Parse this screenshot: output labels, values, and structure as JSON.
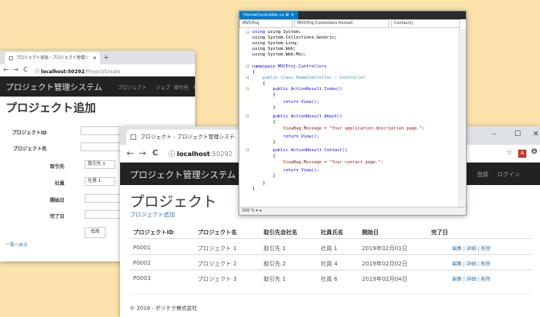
{
  "create_browser": {
    "tab_title": "プロジェクト追加 - プロジェクト管理シ",
    "url_host": "localhost:50292",
    "url_path": "/Project/Create",
    "brand": "プロジェクト管理システム",
    "nav": [
      "プロジェクト",
      "ジョブ",
      "取引先",
      "社員"
    ],
    "page_title": "プロジェクト追加",
    "fields": {
      "project_id": "プロジェクトID",
      "project_name": "プロジェクト名",
      "client": "取引先",
      "client_value": "取引先 1",
      "employee": "社員",
      "employee_value": "社員 1",
      "start_date": "開始日",
      "end_date": "完了日"
    },
    "add_button": "追加",
    "back_link": "一覧へ戻る"
  },
  "index_browser": {
    "tab_title": "プロジェクト - プロジェクト管理システ.",
    "url_host": "localhost",
    "url_port": ":50292",
    "brand": "プロジェクト管理システム",
    "nav_right": [
      "登録",
      "ログイン"
    ],
    "page_title": "プロジェクト",
    "create_link": "プロジェクト追加",
    "columns": [
      "プロジェクトID",
      "プロジェクト名",
      "取引先会社名",
      "社員氏名",
      "開始日",
      "完了日"
    ],
    "rows": [
      {
        "id": "P0001",
        "name": "プロジェクト 1",
        "client": "取引先 1",
        "employee": "社員 1",
        "start": "2019年02月01日",
        "end": ""
      },
      {
        "id": "P0002",
        "name": "プロジェクト 2",
        "client": "取引先 2",
        "employee": "社員 4",
        "start": "2019年02月02日",
        "end": ""
      },
      {
        "id": "P0003",
        "name": "プロジェクト 3",
        "client": "取引先 1",
        "employee": "社員 6",
        "start": "2019年02月04日",
        "end": ""
      }
    ],
    "row_actions": "編集 | 詳細 | 削除",
    "footer": "© 2019 - ポリテク株式会社"
  },
  "vs_editor": {
    "tab": "HomeController.cs",
    "project_dropdown": "MVCProj",
    "class_dropdown": "MVCProj.Controllers.HomeC",
    "member_dropdown": "Contact()",
    "zoom": "100 %",
    "code": {
      "l1": "using System;",
      "l2": "using System.Collections.Generic;",
      "l3": "using System.Linq;",
      "l4": "using System.Web;",
      "l5": "using System.Web.Mvc;",
      "l6": "namespace MVCProj.Controllers",
      "l7": "{",
      "l8": "    public class HomeController : Controller",
      "l9": "    {",
      "l10": "        public ActionResult Index()",
      "l11": "        {",
      "l12": "            return View();",
      "l13": "        }",
      "l14": "        public ActionResult About()",
      "l15": "        {",
      "l16": "            ViewBag.Message = \"Your application description page.\";",
      "l17": "            return View();",
      "l18": "        }",
      "l19": "        public ActionResult Contact()",
      "l20": "        {",
      "l21": "            ViewBag.Message = \"Your contact page.\";",
      "l22": "            return View();",
      "l23": "        }",
      "l24": "    }",
      "l25": "}"
    }
  }
}
